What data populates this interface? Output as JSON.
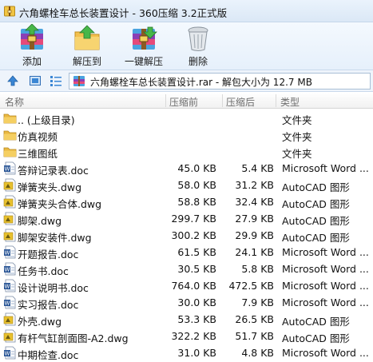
{
  "window": {
    "title": "六角螺栓车总长装置设计 - 360压缩 3.2正式版"
  },
  "toolbar": {
    "add": "添加",
    "extract_to": "解压到",
    "one_click_extract": "一键解压",
    "delete": "删除"
  },
  "address": {
    "text": "六角螺栓车总长装置设计.rar - 解包大小为 12.7 MB"
  },
  "columns": {
    "name": "名称",
    "packed": "压缩前",
    "size": "压缩后",
    "type": "类型"
  },
  "files": [
    {
      "name": ".. (上级目录)",
      "packed": "",
      "size": "",
      "type": "文件夹",
      "icon": "folder-icon"
    },
    {
      "name": "仿真视频",
      "packed": "",
      "size": "",
      "type": "文件夹",
      "icon": "folder-icon"
    },
    {
      "name": "三维图纸",
      "packed": "",
      "size": "",
      "type": "文件夹",
      "icon": "folder-icon"
    },
    {
      "name": "答辩记录表.doc",
      "packed": "45.0 KB",
      "size": "5.4 KB",
      "type": "Microsoft Word ...",
      "icon": "word-doc-icon"
    },
    {
      "name": "弹簧夹头.dwg",
      "packed": "58.0 KB",
      "size": "31.2 KB",
      "type": "AutoCAD 图形",
      "icon": "dwg-file-icon"
    },
    {
      "name": "弹簧夹头合体.dwg",
      "packed": "58.8 KB",
      "size": "32.4 KB",
      "type": "AutoCAD 图形",
      "icon": "dwg-file-icon"
    },
    {
      "name": "脚架.dwg",
      "packed": "299.7 KB",
      "size": "27.9 KB",
      "type": "AutoCAD 图形",
      "icon": "dwg-file-icon"
    },
    {
      "name": "脚架安装件.dwg",
      "packed": "300.2 KB",
      "size": "29.9 KB",
      "type": "AutoCAD 图形",
      "icon": "dwg-file-icon"
    },
    {
      "name": "开题报告.doc",
      "packed": "61.5 KB",
      "size": "24.1 KB",
      "type": "Microsoft Word ...",
      "icon": "word-doc-icon"
    },
    {
      "name": "任务书.doc",
      "packed": "30.5 KB",
      "size": "5.8 KB",
      "type": "Microsoft Word ...",
      "icon": "word-doc-icon"
    },
    {
      "name": "设计说明书.doc",
      "packed": "764.0 KB",
      "size": "472.5 KB",
      "type": "Microsoft Word ...",
      "icon": "word-doc-icon"
    },
    {
      "name": "实习报告.doc",
      "packed": "30.0 KB",
      "size": "7.9 KB",
      "type": "Microsoft Word ...",
      "icon": "word-doc-icon"
    },
    {
      "name": "外壳.dwg",
      "packed": "53.3 KB",
      "size": "26.5 KB",
      "type": "AutoCAD 图形",
      "icon": "dwg-file-icon"
    },
    {
      "name": "有杆气缸剖面图-A2.dwg",
      "packed": "322.2 KB",
      "size": "51.7 KB",
      "type": "AutoCAD 图形",
      "icon": "dwg-file-icon"
    },
    {
      "name": "中期检查.doc",
      "packed": "31.0 KB",
      "size": "4.8 KB",
      "type": "Microsoft Word ...",
      "icon": "word-doc-icon"
    }
  ],
  "colors": {
    "folder": "#e9b842",
    "word_blue": "#2b5797",
    "dwg_yellow": "#e8c12e",
    "selection_accent": "#3a7bd5"
  }
}
